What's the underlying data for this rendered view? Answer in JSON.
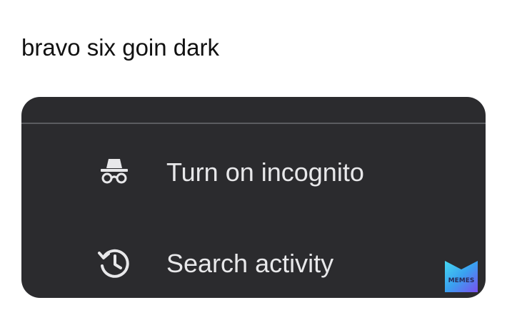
{
  "caption": "bravo six goin dark",
  "menu": {
    "items": [
      {
        "label": "Turn on incognito",
        "icon": "incognito-icon"
      },
      {
        "label": "Search activity",
        "icon": "history-icon"
      }
    ]
  },
  "watermark": {
    "text": "MEMES",
    "icon": "memes-logo-icon"
  },
  "colors": {
    "menu_background": "#2b2b2e",
    "menu_text": "#e8e8ea",
    "divider": "#5b5c60",
    "caption_text": "#111111"
  }
}
